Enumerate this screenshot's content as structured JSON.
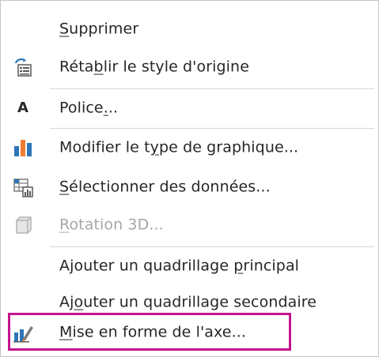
{
  "menu": {
    "items": [
      {
        "label_pre": "",
        "label_key": "S",
        "label_post": "upprimer",
        "icon": "none",
        "disabled": false
      },
      {
        "label_pre": "Réta",
        "label_key": "b",
        "label_post": "lir le style d'origine",
        "icon": "reset-style-icon",
        "disabled": false
      },
      {
        "label_pre": "Police",
        "label_key": ".",
        "label_post": "..",
        "icon": "font-icon",
        "icon_text": "A",
        "disabled": false
      },
      {
        "label_pre": "Modifier le t",
        "label_key": "y",
        "label_post": "pe de graphique...",
        "icon": "change-chart-type-icon",
        "disabled": false
      },
      {
        "label_pre": "",
        "label_key": "S",
        "label_post": "électionner des données...",
        "icon": "select-data-icon",
        "disabled": false
      },
      {
        "label_pre": "",
        "label_key": "R",
        "label_post": "otation 3D...",
        "icon": "rotation-3d-icon",
        "disabled": true
      },
      {
        "label_pre": "Ajouter un quadrillage ",
        "label_key": "p",
        "label_post": "rincipal",
        "icon": "none",
        "disabled": false
      },
      {
        "label_pre": "Aj",
        "label_key": "o",
        "label_post": "uter un quadrillage secondaire",
        "icon": "none",
        "disabled": false
      },
      {
        "label_pre": "",
        "label_key": "M",
        "label_post": "ise en forme de l'axe...",
        "icon": "format-axis-icon",
        "disabled": false
      }
    ]
  },
  "colors": {
    "highlight": "#c5158f",
    "text": "#262626",
    "disabled_text": "#a6a6a6",
    "icon_blue": "#2e75b6",
    "icon_orange": "#ed7d31",
    "icon_gray": "#7f7f7f"
  }
}
